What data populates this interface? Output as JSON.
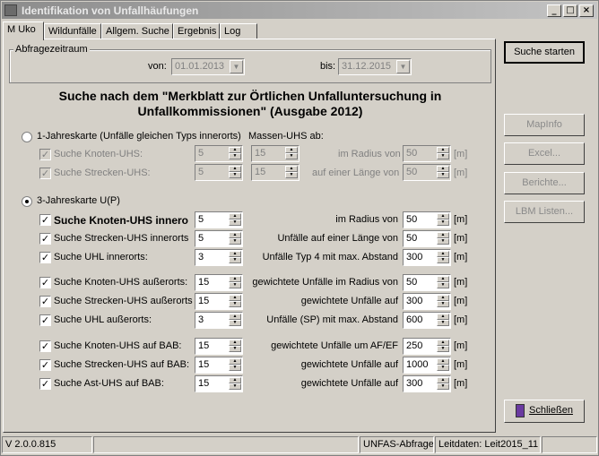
{
  "window": {
    "title": "Identifikation von Unfallhäufungen"
  },
  "tabs": [
    "M Uko",
    "Wildunfälle",
    "Allgem. Suche",
    "Ergebnis",
    "Log"
  ],
  "abfrage": {
    "label": "Abfragezeitraum",
    "von_label": "von:",
    "von": "01.01.2013",
    "bis_label": "bis:",
    "bis": "31.12.2015"
  },
  "heading": "Suche nach dem \"Merkblatt zur Örtlichen Unfalluntersuchung in Unfallkommissionen\" (Ausgabe 2012)",
  "jahr1": {
    "label": "1-Jahreskarte (Unfälle gleichen Typs innerorts)",
    "massen_label": "Massen-UHS ab:",
    "rows": [
      {
        "label": "Suche Knoten-UHS:",
        "v1": "5",
        "v2": "15",
        "right_label": "im Radius von",
        "v3": "50",
        "unit": "[m]"
      },
      {
        "label": "Suche Strecken-UHS:",
        "v1": "5",
        "v2": "15",
        "right_label": "auf einer Länge von",
        "v3": "50",
        "unit": "[m]"
      }
    ]
  },
  "jahr3": {
    "label": "3-Jahreskarte U(P)",
    "rows": [
      {
        "label": "Suche Knoten-UHS innero",
        "v": "5",
        "right_label": "im Radius von",
        "rv": "50",
        "unit": "[m]"
      },
      {
        "label": "Suche Strecken-UHS innerorts",
        "v": "5",
        "right_label": "Unfälle auf einer Länge von",
        "rv": "50",
        "unit": "[m]"
      },
      {
        "label": "Suche UHL innerorts:",
        "v": "3",
        "right_label": "Unfälle Typ 4 mit max. Abstand",
        "rv": "300",
        "unit": "[m]"
      },
      {
        "label": "Suche Knoten-UHS außerorts:",
        "v": "15",
        "right_label": "gewichtete Unfälle im Radius von",
        "rv": "50",
        "unit": "[m]"
      },
      {
        "label": "Suche Strecken-UHS außerorts",
        "v": "15",
        "right_label": "gewichtete Unfälle auf",
        "rv": "300",
        "unit": "[m]"
      },
      {
        "label": "Suche UHL außerorts:",
        "v": "3",
        "right_label": "Unfälle (SP) mit max. Abstand",
        "rv": "600",
        "unit": "[m]"
      },
      {
        "label": "Suche Knoten-UHS auf BAB:",
        "v": "15",
        "right_label": "gewichtete Unfälle um AF/EF",
        "rv": "250",
        "unit": "[m]"
      },
      {
        "label": "Suche Strecken-UHS auf BAB:",
        "v": "15",
        "right_label": "gewichtete Unfälle auf",
        "rv": "1000",
        "unit": "[m]"
      },
      {
        "label": "Suche Ast-UHS auf BAB:",
        "v": "15",
        "right_label": "gewichtete Unfälle auf",
        "rv": "300",
        "unit": "[m]"
      }
    ]
  },
  "buttons": {
    "suche": "Suche starten",
    "mapinfo": "MapInfo",
    "excel": "Excel...",
    "berichte": "Berichte...",
    "lbm": "LBM Listen...",
    "close": "Schließen"
  },
  "status": {
    "version": "V 2.0.0.815",
    "mode": "UNFAS-Abfrage",
    "leitdaten": "Leitdaten: Leit2015_11"
  }
}
